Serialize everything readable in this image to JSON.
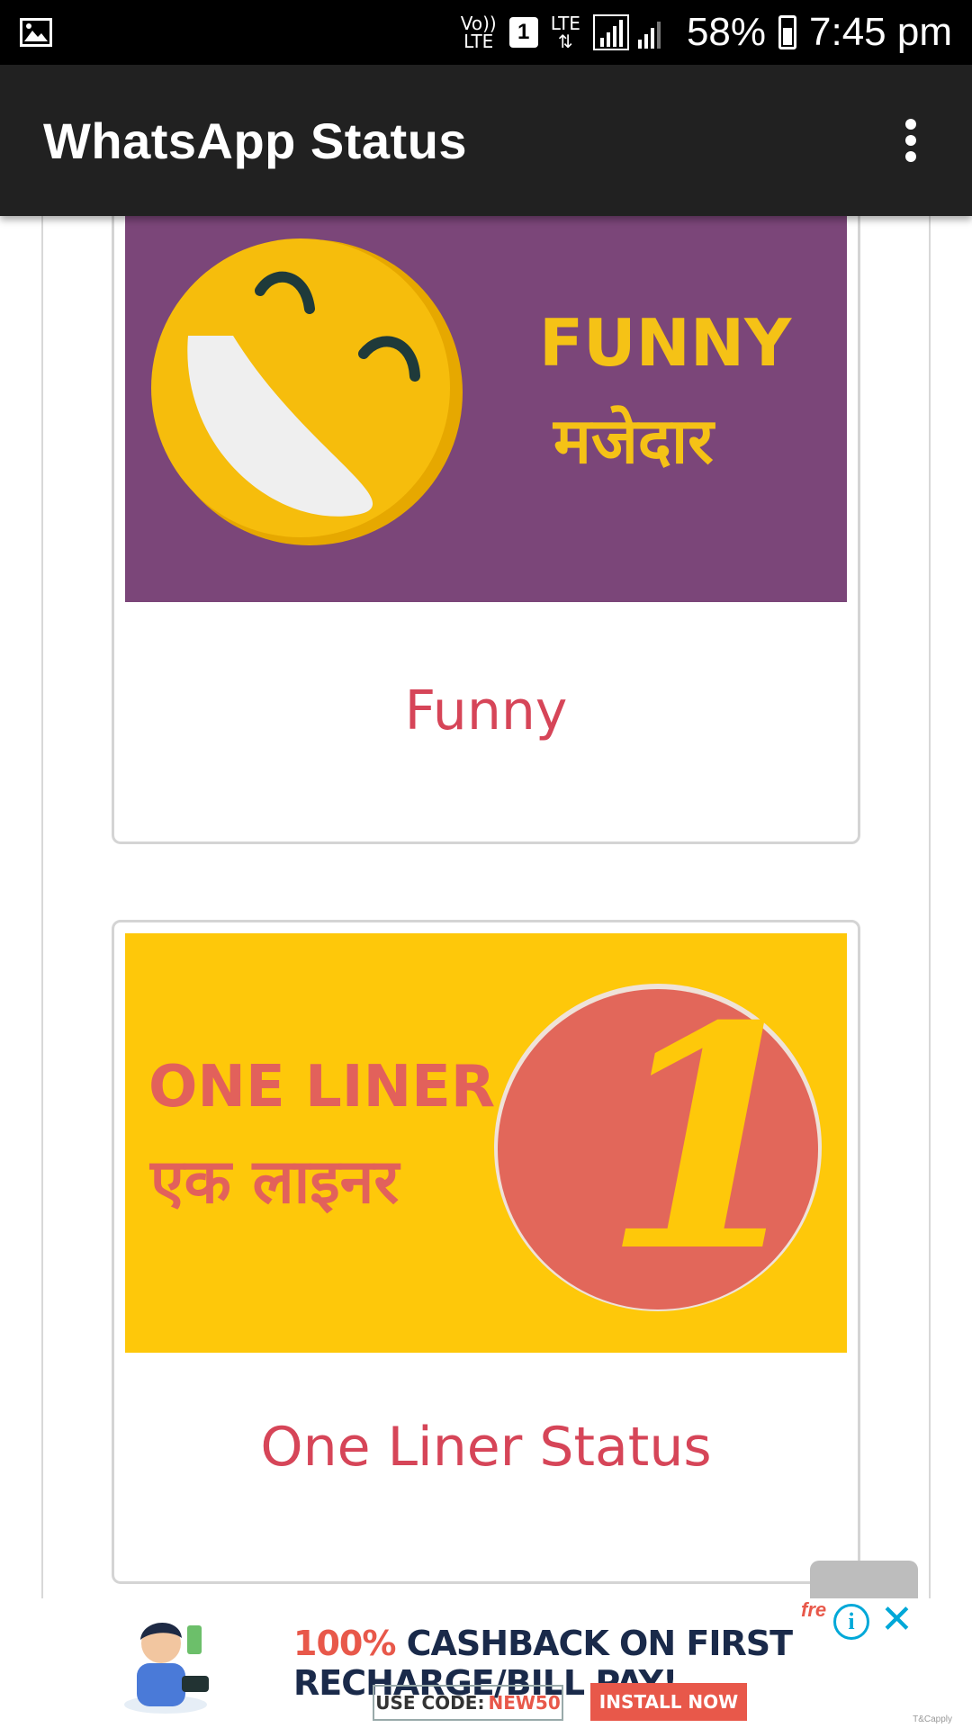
{
  "status_bar": {
    "volte_label": "Vo))\nLTE",
    "sim_label": "1",
    "lte_label": "LTE",
    "battery_pct": "58%",
    "battery_level": 0.58,
    "time": "7:45 pm",
    "icons": [
      "gallery-notification-icon",
      "volte-icon",
      "sim-icon",
      "lte-data-icon",
      "signal-icon",
      "battery-icon"
    ]
  },
  "app_bar": {
    "title": "WhatsApp Status",
    "menu_icon": "overflow-menu-icon"
  },
  "categories": [
    {
      "label": "Funny",
      "banner_line1": "FUNNY",
      "banner_line2": "मजेदार",
      "banner_bg": "#7b4679",
      "banner_text_color": "#f5c216"
    },
    {
      "label": "One Liner Status",
      "banner_line1": "ONE LINER",
      "banner_line2": "एक लाइनर",
      "banner_bg": "#fec80a",
      "banner_text_color": "#e2615b",
      "badge_text": "1"
    }
  ],
  "ad": {
    "headline_pct": "100%",
    "headline_rest": " CASHBACK ON FIRST RECHARGE/BILL PAY!",
    "code_label": "USE CODE:",
    "code_value": "NEW50",
    "install_label": "INSTALL NOW",
    "free_label": "fre",
    "info_label": "i",
    "close_label": "✕",
    "tiny_label": "T&Capply"
  },
  "colors": {
    "accent_label": "#d64558",
    "app_bar_bg": "#212121",
    "ad_accent": "#e8584a"
  }
}
